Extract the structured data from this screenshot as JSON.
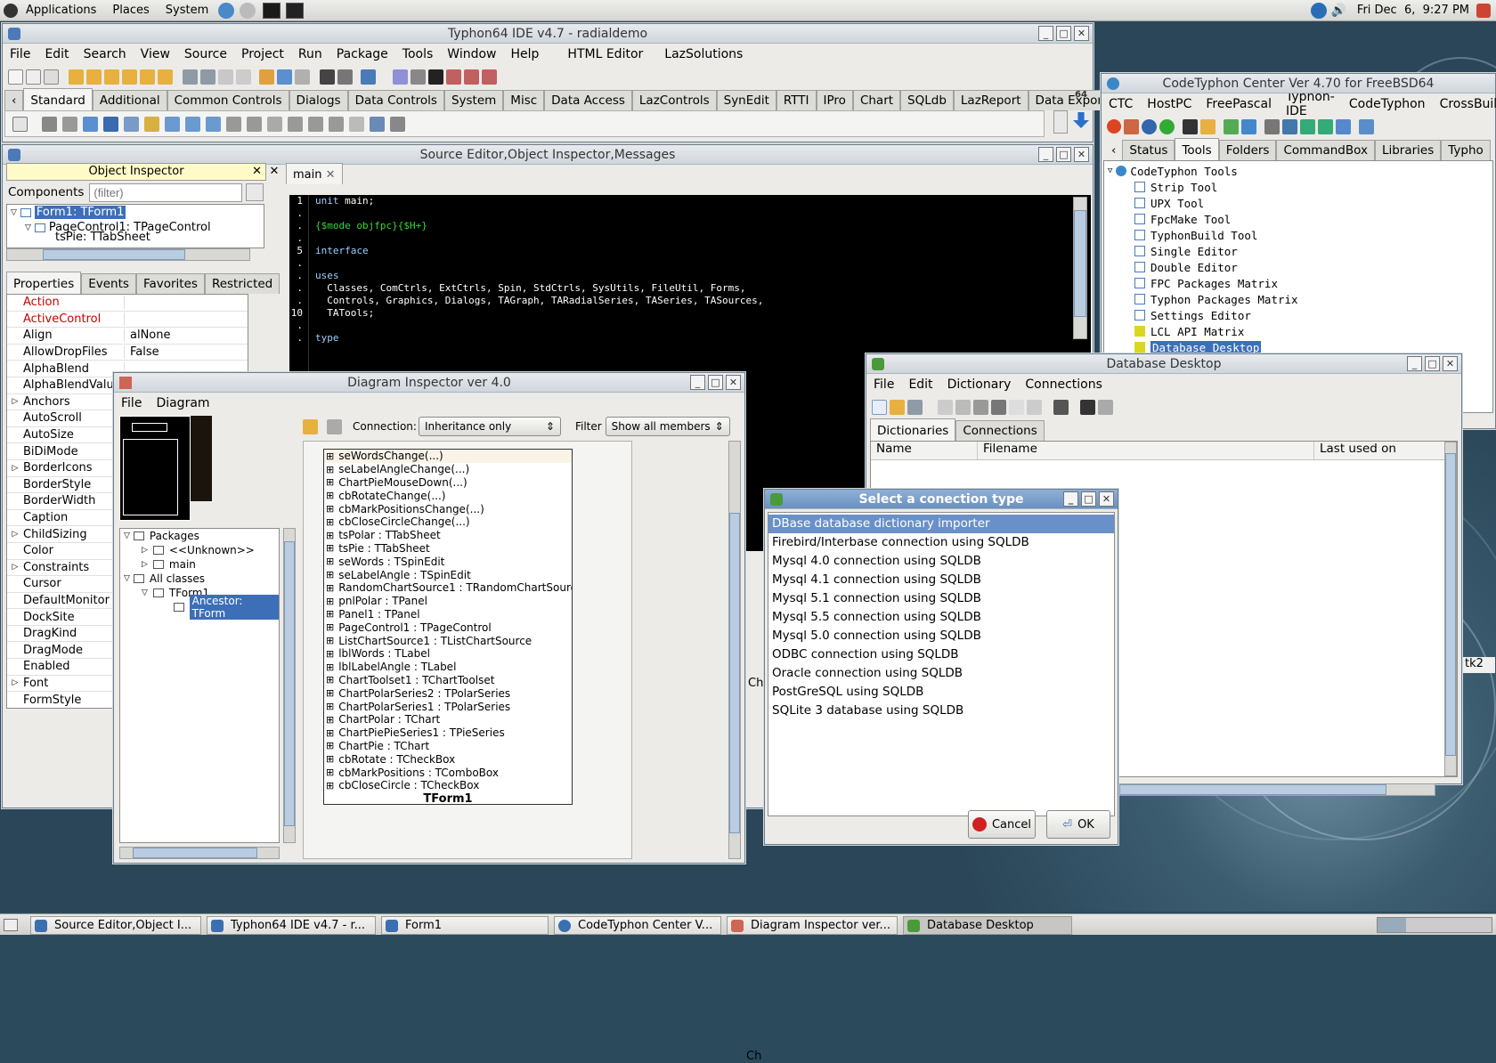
{
  "top_panel": {
    "menus": [
      "Applications",
      "Places",
      "System"
    ],
    "clock": "Fri Dec  6,  9:27 PM"
  },
  "taskbar": [
    {
      "label": "Source Editor,Object I..."
    },
    {
      "label": "Typhon64 IDE v4.7 - r..."
    },
    {
      "label": "Form1"
    },
    {
      "label": "CodeTyphon Center V..."
    },
    {
      "label": "Diagram Inspector ver..."
    },
    {
      "label": "Database Desktop"
    }
  ],
  "ide": {
    "title": "Typhon64 IDE v4.7 - radialdemo",
    "menu": [
      "File",
      "Edit",
      "Search",
      "View",
      "Source",
      "Project",
      "Run",
      "Package",
      "Tools",
      "Window",
      "Help",
      "HTML Editor",
      "LazSolutions"
    ],
    "palette_tabs": [
      "Standard",
      "Additional",
      "Common Controls",
      "Dialogs",
      "Data Controls",
      "System",
      "Misc",
      "Data Access",
      "LazControls",
      "SynEdit",
      "RTTI",
      "IPro",
      "Chart",
      "SQLdb",
      "LazReport",
      "Data Export"
    ],
    "badge": "64"
  },
  "source_editor": {
    "title": "Source Editor,Object Inspector,Messages",
    "tab": "main",
    "lines": [
      {
        "n": "1",
        "html": "<span class='kw'>unit</span> main;"
      },
      {
        "n": ".",
        "html": ""
      },
      {
        "n": ".",
        "html": "<span class='cm'>{$mode objfpc}{$H+}</span>"
      },
      {
        "n": ".",
        "html": ""
      },
      {
        "n": "5",
        "html": "<span class='kw'>interface</span>"
      },
      {
        "n": ".",
        "html": ""
      },
      {
        "n": ".",
        "html": "<span class='kw'>uses</span>"
      },
      {
        "n": ".",
        "html": "  Classes, ComCtrls, ExtCtrls, Spin, StdCtrls, SysUtils, FileUtil, Forms,"
      },
      {
        "n": ".",
        "html": "  Controls, Graphics, Dialogs, TAGraph, TARadialSeries, TASeries, TASources,"
      },
      {
        "n": "10",
        "html": "  TATools;"
      },
      {
        "n": ".",
        "html": ""
      },
      {
        "n": ".",
        "html": "<span class='kw'>type</span>"
      }
    ]
  },
  "object_inspector": {
    "title": "Object Inspector",
    "components_label": "Components",
    "filter_placeholder": "(filter)",
    "tree": [
      "Form1: TForm1",
      "PageControl1: TPageControl",
      "tsPie: TTabSheet"
    ],
    "tabs": [
      "Properties",
      "Events",
      "Favorites",
      "Restricted"
    ],
    "props": [
      {
        "name": "Action",
        "value": "",
        "red": true
      },
      {
        "name": "ActiveControl",
        "value": "",
        "red": true
      },
      {
        "name": "Align",
        "value": "alNone"
      },
      {
        "name": "AllowDropFiles",
        "value": "False"
      },
      {
        "name": "AlphaBlend",
        "value": ""
      },
      {
        "name": "AlphaBlendValu",
        "value": ""
      },
      {
        "name": "Anchors",
        "value": "",
        "exp": true
      },
      {
        "name": "AutoScroll",
        "value": ""
      },
      {
        "name": "AutoSize",
        "value": ""
      },
      {
        "name": "BiDiMode",
        "value": ""
      },
      {
        "name": "BorderIcons",
        "value": "",
        "exp": true
      },
      {
        "name": "BorderStyle",
        "value": ""
      },
      {
        "name": "BorderWidth",
        "value": ""
      },
      {
        "name": "Caption",
        "value": ""
      },
      {
        "name": "ChildSizing",
        "value": "",
        "exp": true
      },
      {
        "name": "Color",
        "value": ""
      },
      {
        "name": "Constraints",
        "value": "",
        "exp": true
      },
      {
        "name": "Cursor",
        "value": ""
      },
      {
        "name": "DefaultMonitor",
        "value": ""
      },
      {
        "name": "DockSite",
        "value": ""
      },
      {
        "name": "DragKind",
        "value": ""
      },
      {
        "name": "DragMode",
        "value": ""
      },
      {
        "name": "Enabled",
        "value": ""
      },
      {
        "name": "Font",
        "value": "",
        "exp": true
      },
      {
        "name": "FormStyle",
        "value": ""
      }
    ]
  },
  "diagram": {
    "title": "Diagram Inspector ver 4.0",
    "menu": [
      "File",
      "Diagram"
    ],
    "connection_label": "Connection:",
    "connection_value": "Inheritance only",
    "filter_label": "Filter",
    "filter_value": "Show all members",
    "tree": {
      "packages": "Packages",
      "unknown": "<<Unknown>>",
      "main": "main",
      "all": "All classes",
      "tform1": "TForm1",
      "ancestor": "Ancestor: TForm"
    },
    "members": [
      "seWordsChange(...)",
      "seLabelAngleChange(...)",
      "ChartPieMouseDown(...)",
      "cbRotateChange(...)",
      "cbMarkPositionsChange(...)",
      "cbCloseCircleChange(...)",
      "tsPolar : TTabSheet",
      "tsPie : TTabSheet",
      "seWords : TSpinEdit",
      "seLabelAngle : TSpinEdit",
      "RandomChartSource1 : TRandomChartSource",
      "pnlPolar : TPanel",
      "Panel1 : TPanel",
      "PageControl1 : TPageControl",
      "ListChartSource1 : TListChartSource",
      "lblWords : TLabel",
      "lblLabelAngle : TLabel",
      "ChartToolset1 : TChartToolset",
      "ChartPolarSeries2 : TPolarSeries",
      "ChartPolarSeries1 : TPolarSeries",
      "ChartPolar : TChart",
      "ChartPiePieSeries1 : TPieSeries",
      "ChartPie : TChart",
      "cbRotate : TCheckBox",
      "cbMarkPositions : TComboBox",
      "cbCloseCircle : TCheckBox"
    ],
    "class_name": "TForm1"
  },
  "center": {
    "title": "CodeTyphon Center Ver 4.70 for FreeBSD64",
    "menu": [
      "CTC",
      "HostPC",
      "FreePascal",
      "Typhon-IDE",
      "CodeTyphon",
      "CrossBuild"
    ],
    "tabs": [
      "Status",
      "Tools",
      "Folders",
      "CommandBox",
      "Libraries",
      "Typho"
    ],
    "root": "CodeTyphon Tools",
    "tools": [
      "Strip Tool",
      "UPX Tool",
      "FpcMake Tool",
      "TyphonBuild Tool",
      "Single Editor",
      "Double Editor",
      "FPC Packages Matrix",
      "Typhon Packages Matrix",
      "Settings Editor",
      "LCL API Matrix",
      "Database Desktop"
    ],
    "side_text": "tk2"
  },
  "dbdesk": {
    "title": "Database Desktop",
    "menu": [
      "File",
      "Edit",
      "Dictionary",
      "Connections"
    ],
    "tabs": [
      "Dictionaries",
      "Connections"
    ],
    "cols": [
      "Name",
      "Filename",
      "Last used on"
    ],
    "partial_label": "Ch"
  },
  "dialog": {
    "title": "Select a conection type",
    "options": [
      "DBase database dictionary importer",
      "Firebird/Interbase connection using SQLDB",
      "Mysql 4.0 connection using SQLDB",
      "Mysql 4.1 connection using SQLDB",
      "Mysql 5.1 connection using SQLDB",
      "Mysql 5.5 connection using SQLDB",
      "Mysql 5.0 connection using SQLDB",
      "ODBC connection using SQLDB",
      "Oracle connection using SQLDB",
      "PostGreSQL using SQLDB",
      "SQLite 3 database using SQLDB"
    ],
    "cancel": "Cancel",
    "ok": "OK"
  }
}
